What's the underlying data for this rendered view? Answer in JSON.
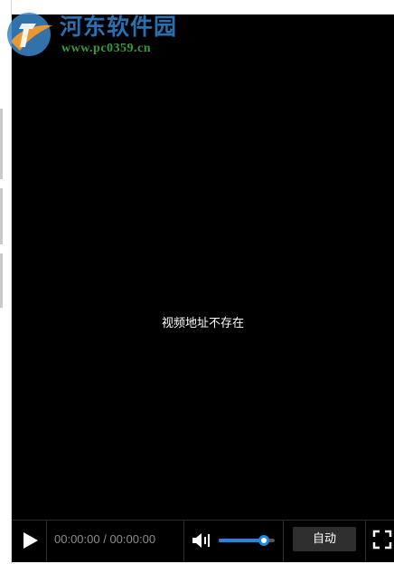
{
  "watermark": {
    "title": "河东软件园",
    "url": "www.pc0359.cn",
    "logo_icon": "pc0359-logo-icon",
    "title_color": "#2a6fb0",
    "url_color": "#3a9a3a"
  },
  "player": {
    "message": "视频地址不存在",
    "background": "#000000",
    "controls": {
      "play_icon": "play-icon",
      "time": "00:00:00 / 00:00:00",
      "volume_icon": "volume-icon",
      "volume_level": 0.8,
      "quality_label": "自动",
      "fullscreen_icon": "fullscreen-icon",
      "accent_color": "#1e88e5"
    }
  }
}
